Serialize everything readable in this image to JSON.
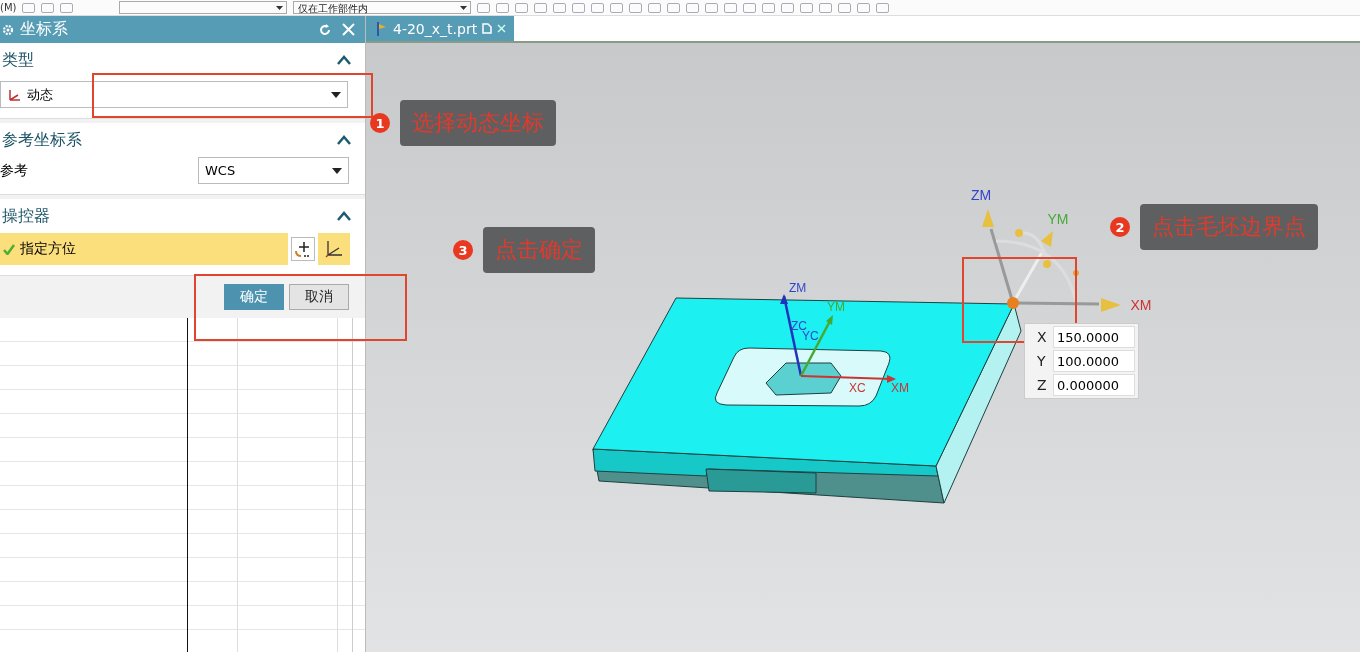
{
  "menu_fragment": "(M)",
  "toolbar": {
    "scope_value": "仅在工作部件内"
  },
  "dialog": {
    "title": "坐标系",
    "type_section": {
      "title": "类型",
      "expanded": true,
      "value": "动态"
    },
    "reference_section": {
      "title": "参考坐标系",
      "expanded": true,
      "label": "参考",
      "value": "WCS"
    },
    "manipulator_section": {
      "title": "操控器",
      "expanded": true,
      "item": "指定方位",
      "done": true
    },
    "buttons": [
      {
        "label": "确定",
        "kind": "primary"
      },
      {
        "label": "取消",
        "kind": "secondary"
      }
    ]
  },
  "tab": {
    "label": "4-20_x_t.prt"
  },
  "viewport": {
    "triad_labels": [
      "ZM",
      "YM",
      "XM"
    ],
    "model_labels": [
      "ZM",
      "YM",
      "ZC",
      "YC",
      "XC",
      "XM"
    ],
    "coordinates": [
      {
        "axis": "X",
        "value": "150.0000"
      },
      {
        "axis": "Y",
        "value": "100.0000"
      },
      {
        "axis": "Z",
        "value": "0.000000"
      }
    ]
  },
  "callouts": [
    {
      "number": "1",
      "text": "选择动态坐标"
    },
    {
      "number": "2",
      "text": "点击毛坯边界点"
    },
    {
      "number": "3",
      "text": "点击确定"
    }
  ]
}
